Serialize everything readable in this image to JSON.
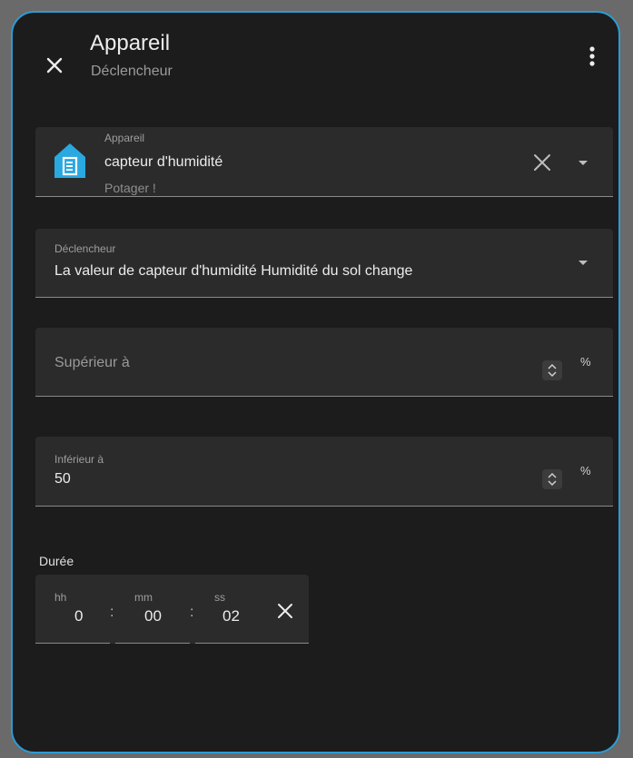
{
  "header": {
    "title": "Appareil",
    "subtitle": "Déclencheur"
  },
  "device_field": {
    "label": "Appareil",
    "value": "capteur d'humidité",
    "area": "Potager !"
  },
  "trigger_field": {
    "label": "Déclencheur",
    "value": "La valeur de capteur d'humidité Humidité du sol change"
  },
  "above_field": {
    "placeholder": "Supérieur à",
    "unit": "%"
  },
  "below_field": {
    "label": "Inférieur à",
    "value": "50",
    "unit": "%"
  },
  "duration": {
    "label": "Durée",
    "hours_label": "hh",
    "hours": "0",
    "minutes_label": "mm",
    "minutes": "00",
    "seconds_label": "ss",
    "seconds": "02",
    "separator": ":"
  },
  "colors": {
    "accent": "#2d9bd6",
    "device_icon": "#2aa8e0",
    "surface": "#1c1c1c",
    "field": "#2b2b2b"
  },
  "icons": [
    "close-icon",
    "more-vertical-icon",
    "home-sensor-icon",
    "clear-icon",
    "dropdown-arrow-icon",
    "spinner-icon"
  ]
}
